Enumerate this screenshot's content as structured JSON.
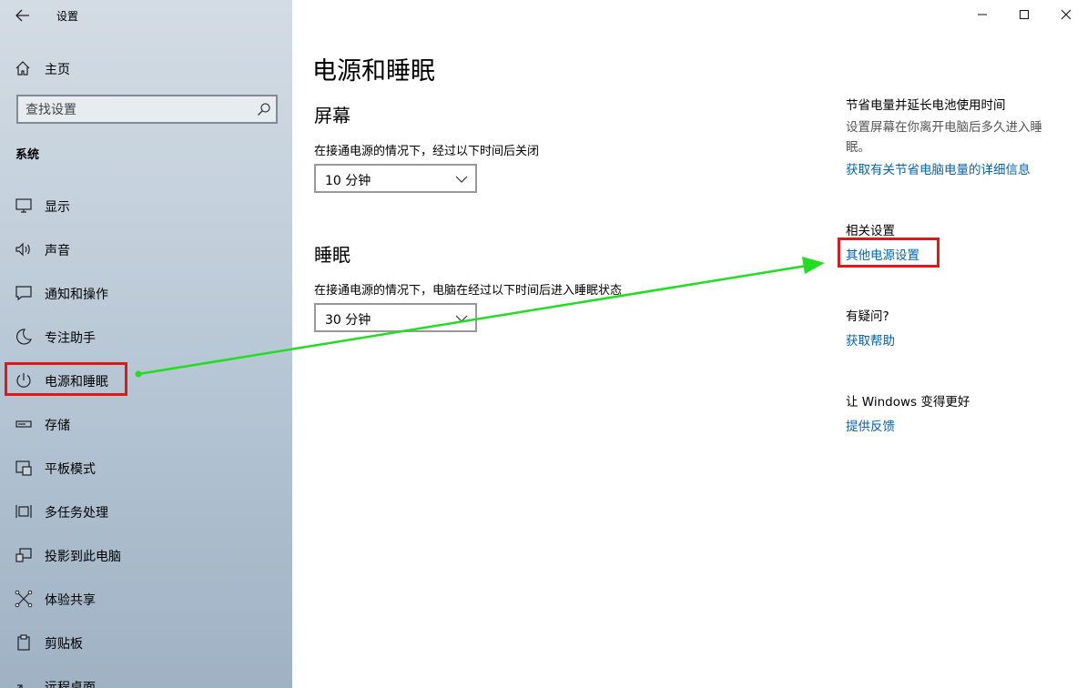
{
  "window": {
    "title": "设置",
    "minimize_symbol": "─",
    "maximize_symbol": "☐",
    "close_symbol": "✕"
  },
  "sidebar": {
    "home_label": "主页",
    "search_placeholder": "查找设置",
    "section_title": "系统",
    "items": [
      {
        "label": "显示",
        "icon": "monitor-icon"
      },
      {
        "label": "声音",
        "icon": "speaker-icon"
      },
      {
        "label": "通知和操作",
        "icon": "notification-icon"
      },
      {
        "label": "专注助手",
        "icon": "moon-icon"
      },
      {
        "label": "电源和睡眠",
        "icon": "power-icon",
        "selected": true
      },
      {
        "label": "存储",
        "icon": "storage-icon"
      },
      {
        "label": "平板模式",
        "icon": "tablet-icon"
      },
      {
        "label": "多任务处理",
        "icon": "multitask-icon"
      },
      {
        "label": "投影到此电脑",
        "icon": "project-icon"
      },
      {
        "label": "体验共享",
        "icon": "share-icon"
      },
      {
        "label": "剪贴板",
        "icon": "clipboard-icon"
      },
      {
        "label": "远程桌面",
        "icon": "remote-desktop-icon"
      }
    ]
  },
  "main": {
    "page_title": "电源和睡眠",
    "screen": {
      "heading": "屏幕",
      "description": "在接通电源的情况下，经过以下时间后关闭",
      "value": "10 分钟"
    },
    "sleep": {
      "heading": "睡眠",
      "description": "在接通电源的情况下，电脑在经过以下时间后进入睡眠状态",
      "value": "30 分钟"
    }
  },
  "right_panel": {
    "save_power": {
      "heading": "节省电量并延长电池使用时间",
      "text": "设置屏幕在你离开电脑后多久进入睡眠。",
      "link": "获取有关节省电脑电量的详细信息"
    },
    "related": {
      "heading": "相关设置",
      "link": "其他电源设置"
    },
    "questions": {
      "heading": "有疑问?",
      "link": "获取帮助"
    },
    "feedback": {
      "heading": "让 Windows 变得更好",
      "link": "提供反馈"
    }
  },
  "colors": {
    "link": "#0063b1",
    "highlight": "#e01818",
    "annotation_arrow": "#22dd22"
  }
}
